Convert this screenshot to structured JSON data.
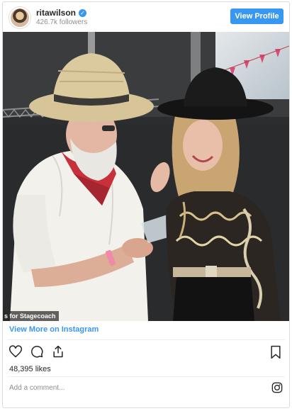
{
  "header": {
    "username": "ritawilson",
    "verified_glyph": "✓",
    "followers": "426.7k followers",
    "view_profile_label": "View Profile"
  },
  "photo": {
    "caption_fragment": "s for Stagecoach"
  },
  "links": {
    "view_more": "View More on Instagram"
  },
  "stats": {
    "likes": "48,395 likes"
  },
  "comment": {
    "placeholder": "Add a comment..."
  },
  "icons": {
    "like": "heart-icon",
    "comment": "comment-icon",
    "share": "share-icon",
    "save": "bookmark-icon",
    "brand": "instagram-icon",
    "verified": "verified-badge-icon"
  },
  "colors": {
    "accent": "#3897f0",
    "text": "#262626",
    "muted": "#8e8e8e",
    "border": "#dbdbdb"
  }
}
